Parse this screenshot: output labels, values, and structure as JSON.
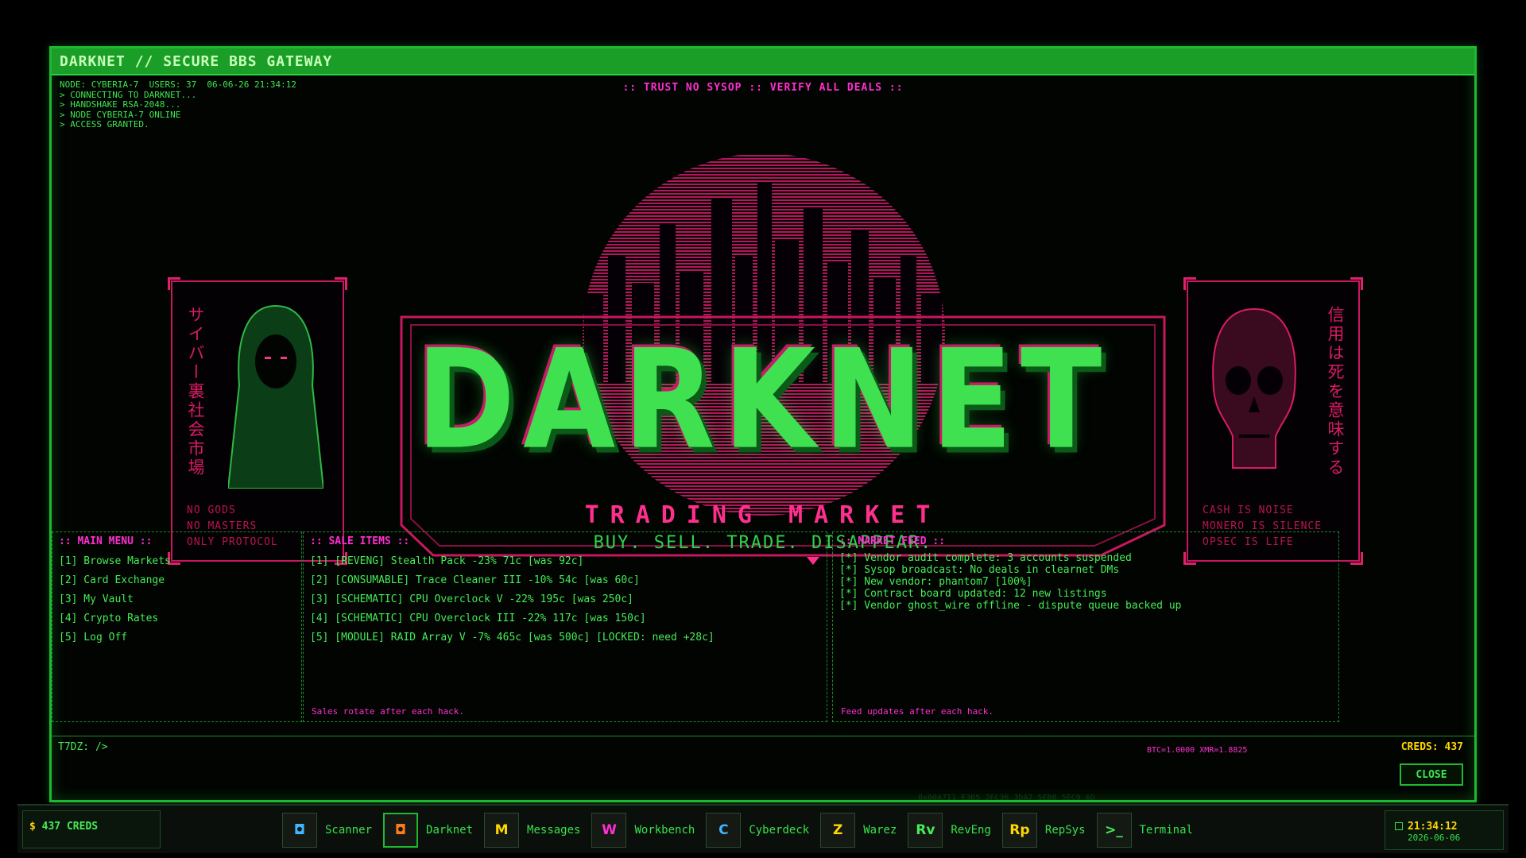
{
  "window": {
    "title": "DARKNET // SECURE BBS GATEWAY",
    "motto": ":: TRUST NO SYSOP :: VERIFY ALL DEALS ::",
    "close_label": "CLOSE"
  },
  "sysinfo": [
    "NODE: CYBERIA-7  USERS: 37  06-06-26 21:34:12",
    "> CONNECTING TO DARKNET...",
    "> HANDSHAKE RSA-2048...",
    "> NODE CYBERIA-7 ONLINE",
    "> ACCESS GRANTED."
  ],
  "hero": {
    "logo": "DARKNET",
    "subtitle": "TRADING MARKET",
    "tagline": "BUY. SELL. TRADE. DISAPPEAR.",
    "left_vertical": "サイバー裏社会市場",
    "left_lines": [
      "NO GODS",
      "NO MASTERS",
      "ONLY PROTOCOL"
    ],
    "right_vertical": "信用は死を意味する",
    "right_lines": [
      "CASH IS NOISE",
      "MONERO IS SILENCE",
      "OPSEC IS LIFE"
    ]
  },
  "menu": {
    "title": ":: MAIN MENU ::",
    "items": [
      "[1] Browse Markets",
      "[2] Card Exchange",
      "[3] My Vault",
      "[4] Crypto Rates",
      "[5] Log Off"
    ]
  },
  "sale": {
    "title": ":: SALE ITEMS ::",
    "items": [
      "[1] [REVENG] Stealth Pack -23% 71c [was 92c]",
      "[2] [CONSUMABLE] Trace Cleaner III -10% 54c [was 60c]",
      "[3] [SCHEMATIC] CPU Overclock V -22% 195c [was 250c]",
      "[4] [SCHEMATIC] CPU Overclock III -22% 117c [was 150c]",
      "[5] [MODULE] RAID Array V -7% 465c [was 500c] [LOCKED: need +28c]"
    ],
    "footer": "Sales rotate after each hack."
  },
  "feed": {
    "title": ":: MARKET FEED ::",
    "items": [
      "[*] Vendor audit complete: 3 accounts suspended",
      "[*] Sysop broadcast: No deals in clearnet DMs",
      "[*] New vendor: phantom7 [100%]",
      "[*] Contract board updated: 12 new listings",
      "[*] Vendor ghost_wire offline - dispute queue backed up"
    ],
    "footer": "Feed updates after each hack."
  },
  "status": {
    "prompt": "T7DZ: />",
    "rates": "BTC=1.0000  XMR=1.8825",
    "creds": "CREDS: 437",
    "hash": "0x00A7I1 E3B5 2FC36 3DA7 5EB8 5EC9 6D"
  },
  "taskbar": {
    "creds": "437 CREDS",
    "creds_symbol": "$",
    "apps": [
      {
        "glyph": "◘",
        "label": "Scanner",
        "color": "#3fb6ff",
        "name": "scanner"
      },
      {
        "glyph": "◘",
        "label": "Darknet",
        "color": "#ff7a1a",
        "name": "darknet"
      },
      {
        "glyph": "M",
        "label": "Messages",
        "color": "#ffd700",
        "name": "messages"
      },
      {
        "glyph": "W",
        "label": "Workbench",
        "color": "#ff2fd0",
        "name": "workbench"
      },
      {
        "glyph": "C",
        "label": "Cyberdeck",
        "color": "#3fb6ff",
        "name": "cyberdeck"
      },
      {
        "glyph": "Z",
        "label": "Warez",
        "color": "#ffd700",
        "name": "warez"
      },
      {
        "glyph": "Rv",
        "label": "RevEng",
        "color": "#45ec56",
        "name": "reveng"
      },
      {
        "glyph": "Rp",
        "label": "RepSys",
        "color": "#ffd700",
        "name": "repsys"
      },
      {
        "glyph": ">_",
        "label": "Terminal",
        "color": "#45ec56",
        "name": "terminal"
      }
    ],
    "clock_time": "21:34:12",
    "clock_date": "2026-06-06"
  }
}
